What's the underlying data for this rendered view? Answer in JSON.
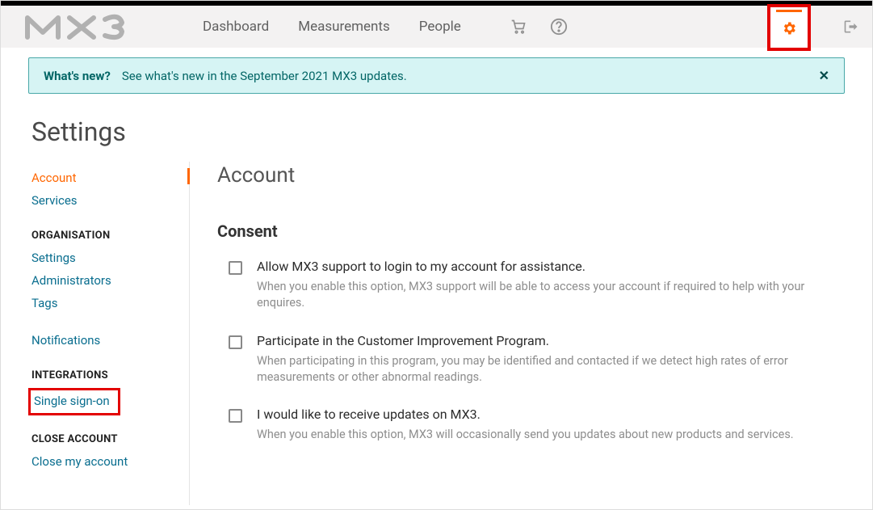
{
  "logo_text": "MX3",
  "nav": {
    "dashboard": "Dashboard",
    "measurements": "Measurements",
    "people": "People"
  },
  "notice": {
    "bold": "What's new?",
    "text": "See what's new in the September 2021 MX3 updates.",
    "close": "✕"
  },
  "page_title": "Settings",
  "sidebar": {
    "account": "Account",
    "services": "Services",
    "org_header": "ORGANISATION",
    "settings": "Settings",
    "administrators": "Administrators",
    "tags": "Tags",
    "notifications": "Notifications",
    "integrations_header": "INTEGRATIONS",
    "sso": "Single sign-on",
    "close_header": "CLOSE ACCOUNT",
    "close_account": "Close my account"
  },
  "main": {
    "title": "Account",
    "consent_header": "Consent",
    "items": [
      {
        "label": "Allow MX3 support to login to my account for assistance.",
        "desc": "When you enable this option, MX3 support will be able to access your account if required to help with your enquires."
      },
      {
        "label": "Participate in the Customer Improvement Program.",
        "desc": "When participating in this program, you may be identified and contacted if we detect high rates of error measurements or other abnormal readings."
      },
      {
        "label": "I would like to receive updates on MX3.",
        "desc": "When you enable this option, MX3 will occasionally send you updates about new products and services."
      }
    ]
  }
}
